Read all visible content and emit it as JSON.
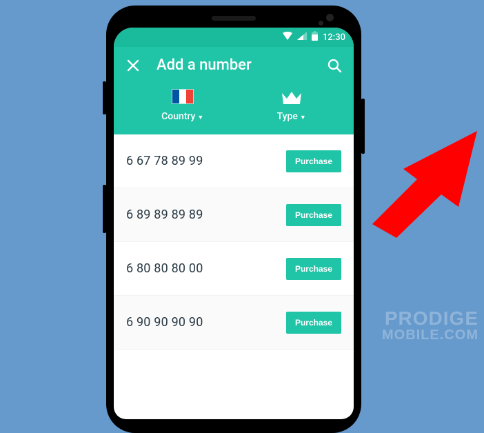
{
  "status_bar": {
    "time": "12:30"
  },
  "app_bar": {
    "title": "Add a number",
    "filters": {
      "country_label": "Country",
      "type_label": "Type"
    }
  },
  "list": {
    "rows": [
      {
        "number": "6 67 78 89 99",
        "action": "Purchase"
      },
      {
        "number": "6 89 89 89 89",
        "action": "Purchase"
      },
      {
        "number": "6 80 80 80 00",
        "action": "Purchase"
      },
      {
        "number": "6 90 90 90 90",
        "action": "Purchase"
      }
    ]
  },
  "watermark": {
    "line1": "PRODIGE",
    "line2": "MOBILE.COM"
  }
}
